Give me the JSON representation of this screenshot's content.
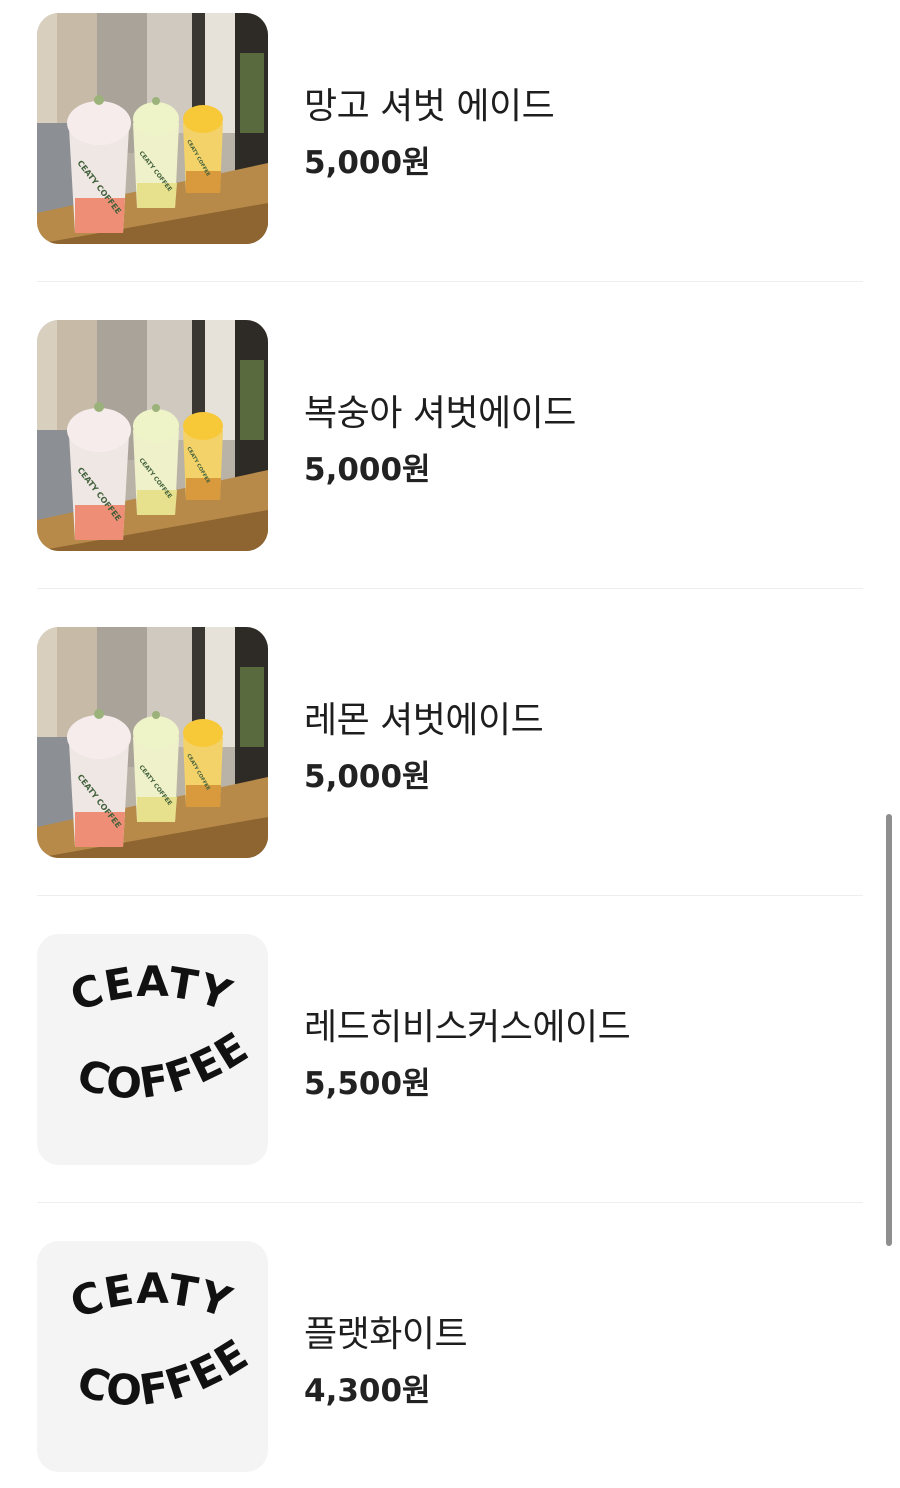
{
  "menu": {
    "items": [
      {
        "name": "망고 셔벗 에이드",
        "price": "5,000원",
        "image": "sherbet-ade-photo"
      },
      {
        "name": "복숭아 셔벗에이드",
        "price": "5,000원",
        "image": "sherbet-ade-photo"
      },
      {
        "name": "레몬 셔벗에이드",
        "price": "5,000원",
        "image": "sherbet-ade-photo"
      },
      {
        "name": "레드히비스커스에이드",
        "price": "5,500원",
        "image": "ceaty-coffee-logo"
      },
      {
        "name": "플랫화이트",
        "price": "4,300원",
        "image": "ceaty-coffee-logo"
      }
    ]
  },
  "logo": {
    "line1": "CEATY",
    "line2": "COFFEE"
  },
  "cup_label": "CEATY COFFEE",
  "colors": {
    "background": "#ffffff",
    "divider": "#eeeeee",
    "logo_tile": "#f4f4f4",
    "scrollbar": "#8e8e8e"
  }
}
